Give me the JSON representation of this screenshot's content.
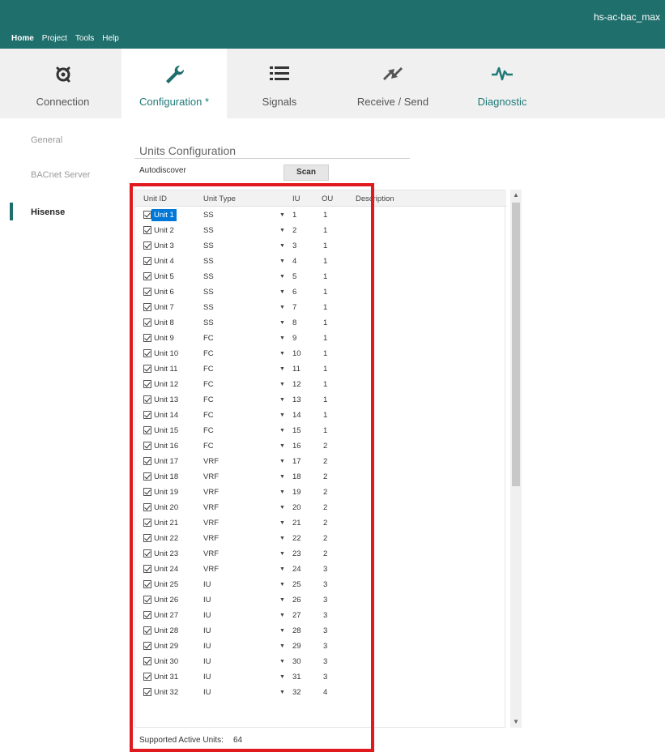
{
  "window": {
    "title": "hs-ac-bac_max"
  },
  "menu": {
    "items": [
      "Home",
      "Project",
      "Tools",
      "Help"
    ]
  },
  "ribbon": {
    "tabs": [
      {
        "label": "Connection",
        "icon": "connection-icon"
      },
      {
        "label": "Configuration *",
        "icon": "wrench-icon",
        "active": true
      },
      {
        "label": "Signals",
        "icon": "list-icon"
      },
      {
        "label": "Receive / Send",
        "icon": "receive-send-icon"
      },
      {
        "label": "Diagnostic",
        "icon": "pulse-icon"
      }
    ]
  },
  "nav": {
    "items": [
      "General",
      "BACnet Server",
      "Hisense"
    ],
    "active": "Hisense"
  },
  "units_config": {
    "title": "Units Configuration",
    "autodiscover_label": "Autodiscover",
    "scan_label": "Scan",
    "columns": [
      "Unit ID",
      "Unit Type",
      "IU",
      "OU",
      "Description"
    ],
    "rows": [
      {
        "id": "Unit 1",
        "type": "SS",
        "iu": "1",
        "ou": "1",
        "checked": true,
        "selected": true
      },
      {
        "id": "Unit 2",
        "type": "SS",
        "iu": "2",
        "ou": "1",
        "checked": true
      },
      {
        "id": "Unit 3",
        "type": "SS",
        "iu": "3",
        "ou": "1",
        "checked": true
      },
      {
        "id": "Unit 4",
        "type": "SS",
        "iu": "4",
        "ou": "1",
        "checked": true
      },
      {
        "id": "Unit 5",
        "type": "SS",
        "iu": "5",
        "ou": "1",
        "checked": true
      },
      {
        "id": "Unit 6",
        "type": "SS",
        "iu": "6",
        "ou": "1",
        "checked": true
      },
      {
        "id": "Unit 7",
        "type": "SS",
        "iu": "7",
        "ou": "1",
        "checked": true
      },
      {
        "id": "Unit 8",
        "type": "SS",
        "iu": "8",
        "ou": "1",
        "checked": true
      },
      {
        "id": "Unit 9",
        "type": "FC",
        "iu": "9",
        "ou": "1",
        "checked": true
      },
      {
        "id": "Unit 10",
        "type": "FC",
        "iu": "10",
        "ou": "1",
        "checked": true
      },
      {
        "id": "Unit 11",
        "type": "FC",
        "iu": "11",
        "ou": "1",
        "checked": true
      },
      {
        "id": "Unit 12",
        "type": "FC",
        "iu": "12",
        "ou": "1",
        "checked": true
      },
      {
        "id": "Unit 13",
        "type": "FC",
        "iu": "13",
        "ou": "1",
        "checked": true
      },
      {
        "id": "Unit 14",
        "type": "FC",
        "iu": "14",
        "ou": "1",
        "checked": true
      },
      {
        "id": "Unit 15",
        "type": "FC",
        "iu": "15",
        "ou": "1",
        "checked": true
      },
      {
        "id": "Unit 16",
        "type": "FC",
        "iu": "16",
        "ou": "2",
        "checked": true
      },
      {
        "id": "Unit 17",
        "type": "VRF",
        "iu": "17",
        "ou": "2",
        "checked": true
      },
      {
        "id": "Unit 18",
        "type": "VRF",
        "iu": "18",
        "ou": "2",
        "checked": true
      },
      {
        "id": "Unit 19",
        "type": "VRF",
        "iu": "19",
        "ou": "2",
        "checked": true
      },
      {
        "id": "Unit 20",
        "type": "VRF",
        "iu": "20",
        "ou": "2",
        "checked": true
      },
      {
        "id": "Unit 21",
        "type": "VRF",
        "iu": "21",
        "ou": "2",
        "checked": true
      },
      {
        "id": "Unit 22",
        "type": "VRF",
        "iu": "22",
        "ou": "2",
        "checked": true
      },
      {
        "id": "Unit 23",
        "type": "VRF",
        "iu": "23",
        "ou": "2",
        "checked": true
      },
      {
        "id": "Unit 24",
        "type": "VRF",
        "iu": "24",
        "ou": "3",
        "checked": true
      },
      {
        "id": "Unit 25",
        "type": "IU",
        "iu": "25",
        "ou": "3",
        "checked": true
      },
      {
        "id": "Unit 26",
        "type": "IU",
        "iu": "26",
        "ou": "3",
        "checked": true
      },
      {
        "id": "Unit 27",
        "type": "IU",
        "iu": "27",
        "ou": "3",
        "checked": true
      },
      {
        "id": "Unit 28",
        "type": "IU",
        "iu": "28",
        "ou": "3",
        "checked": true
      },
      {
        "id": "Unit 29",
        "type": "IU",
        "iu": "29",
        "ou": "3",
        "checked": true
      },
      {
        "id": "Unit 30",
        "type": "IU",
        "iu": "30",
        "ou": "3",
        "checked": true
      },
      {
        "id": "Unit 31",
        "type": "IU",
        "iu": "31",
        "ou": "3",
        "checked": true
      },
      {
        "id": "Unit 32",
        "type": "IU",
        "iu": "32",
        "ou": "4",
        "checked": true
      }
    ],
    "supported_label": "Supported Active Units:",
    "supported_value": "64"
  },
  "colors": {
    "accent": "#1f6f6d",
    "highlight": "#e0191f",
    "selection": "#0078d7"
  }
}
